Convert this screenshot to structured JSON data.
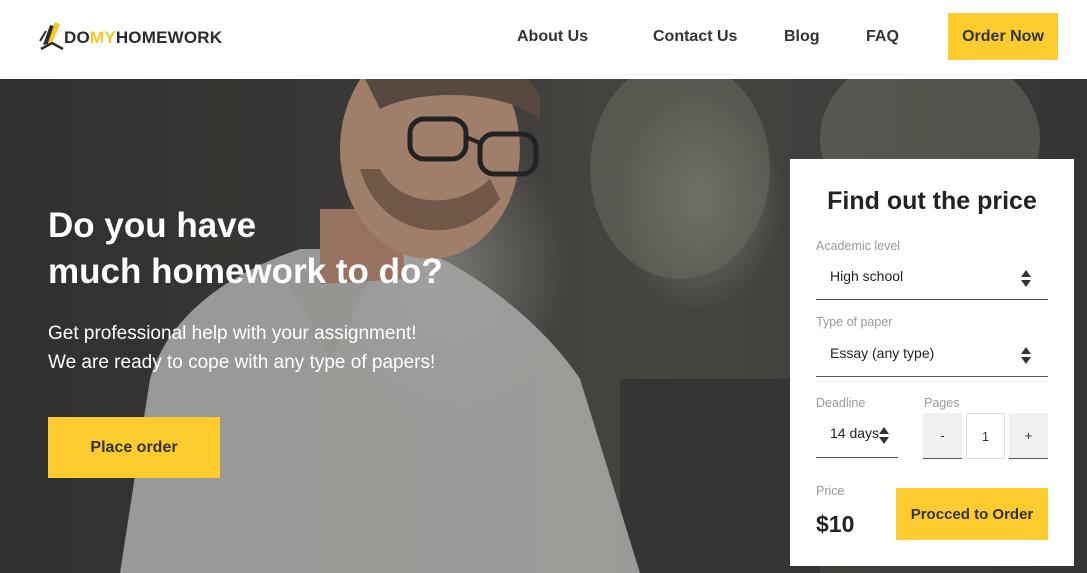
{
  "brand": {
    "part1": "DO",
    "part2": "MY",
    "part3": "HOMEWORK",
    "accent_color": "#fccb2e"
  },
  "nav": {
    "about": "About Us",
    "contact": "Contact Us",
    "blog": "Blog",
    "faq": "FAQ",
    "order_now": "Order Now"
  },
  "hero": {
    "title_line1": "Do you have",
    "title_line2": "much homework to do?",
    "sub_line1": "Get professional help with your assignment!",
    "sub_line2": "We are ready to cope with any type of papers!",
    "cta": "Place order"
  },
  "price_form": {
    "title": "Find out the price",
    "academic_level": {
      "label": "Academic level",
      "value": "High school"
    },
    "paper_type": {
      "label": "Type of paper",
      "value": "Essay (any type)"
    },
    "deadline": {
      "label": "Deadline",
      "value": "14 days"
    },
    "pages": {
      "label": "Pages",
      "value": "1",
      "minus": "-",
      "plus": "+"
    },
    "price": {
      "label": "Price",
      "value": "$10"
    },
    "proceed": "Procced to Order"
  }
}
